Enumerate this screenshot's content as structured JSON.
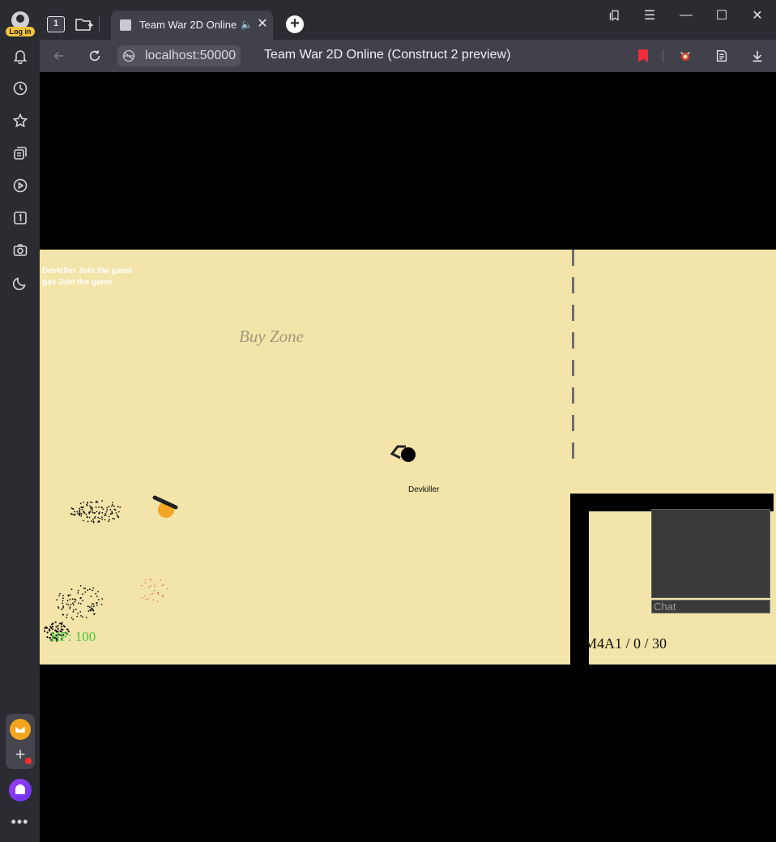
{
  "browser": {
    "login_label": "Log in",
    "tab_count": "1",
    "tab": {
      "title": "Team War 2D Online"
    },
    "url": "localhost:50000",
    "page_title": "Team War 2D Online (Construct 2 preview)",
    "colors": {
      "bookmark": "#f52b3b",
      "login_badge": "#f6c53d"
    }
  },
  "sidebar": {
    "items": [
      "bell-icon",
      "history-icon",
      "star-icon",
      "collections-icon",
      "play-icon",
      "tab-counter-icon",
      "screenshot-icon",
      "night-mode-icon"
    ],
    "bottom": [
      "mail-icon",
      "add-panel-icon",
      "alice-icon",
      "more-icon"
    ]
  },
  "game": {
    "join_messages": [
      "Devkiller Join the game",
      "gas Join the game"
    ],
    "buy_zone_label": "Buy Zone",
    "player_name": "Devkiller",
    "hp_text": "HP: 100",
    "ammo_text": "M4A1 / 0 / 30",
    "chat_placeholder": "Chat",
    "colors": {
      "floor": "#f3e4a9",
      "hp": "#3ccf3c",
      "enemy": "#f5a623"
    }
  }
}
